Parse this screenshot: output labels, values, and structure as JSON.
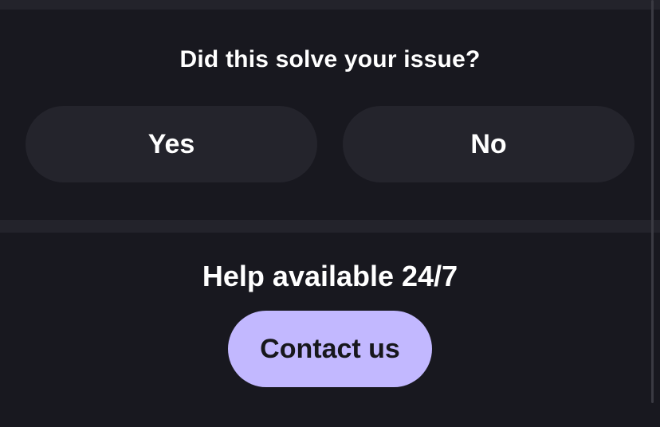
{
  "feedback": {
    "question": "Did this solve your issue?",
    "yes_label": "Yes",
    "no_label": "No"
  },
  "help": {
    "heading": "Help available 24/7",
    "contact_label": "Contact us"
  },
  "colors": {
    "background": "#18181f",
    "button_background": "#24242c",
    "accent": "#c2b8ff",
    "text": "#ffffff"
  }
}
